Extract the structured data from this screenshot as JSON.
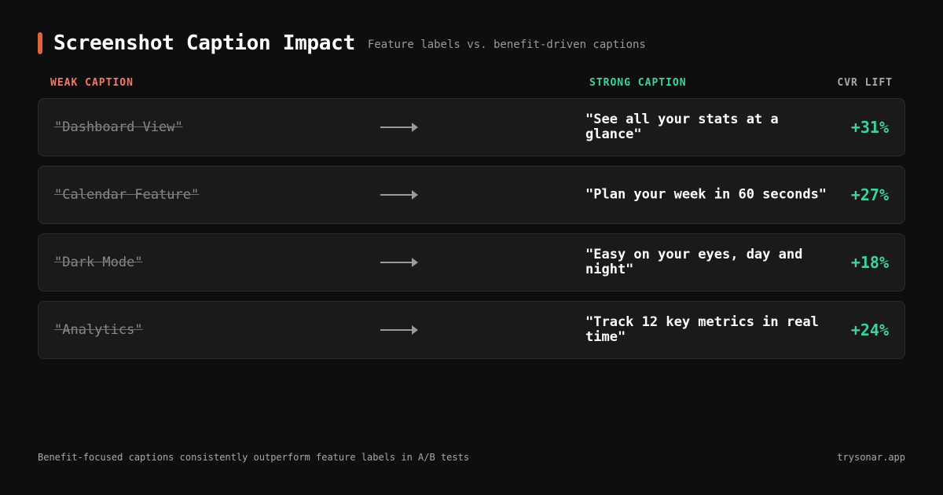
{
  "header": {
    "title": "Screenshot Caption Impact",
    "subtitle": "Feature labels vs. benefit-driven captions",
    "accent_color": "#e0643c"
  },
  "columns": {
    "weak": "WEAK CAPTION",
    "strong": "STRONG CAPTION",
    "lift": "CVR LIFT"
  },
  "rows": [
    {
      "weak": "\"Dashboard View\"",
      "strong": "\"See all your stats at a glance\"",
      "lift": "+31%"
    },
    {
      "weak": "\"Calendar Feature\"",
      "strong": "\"Plan your week in 60 seconds\"",
      "lift": "+27%"
    },
    {
      "weak": "\"Dark Mode\"",
      "strong": "\"Easy on your eyes, day and night\"",
      "lift": "+18%"
    },
    {
      "weak": "\"Analytics\"",
      "strong": "\"Track 12 key metrics in real time\"",
      "lift": "+24%"
    }
  ],
  "footer": {
    "note": "Benefit-focused captions consistently outperform feature labels in A/B tests",
    "brand": "trysonar.app"
  },
  "colors": {
    "weak": "#f07a6a",
    "strong": "#3fd1a0",
    "background": "#0e0e0e",
    "card": "#1a1a1a"
  },
  "icons": {
    "arrow": "arrow-right-icon"
  }
}
